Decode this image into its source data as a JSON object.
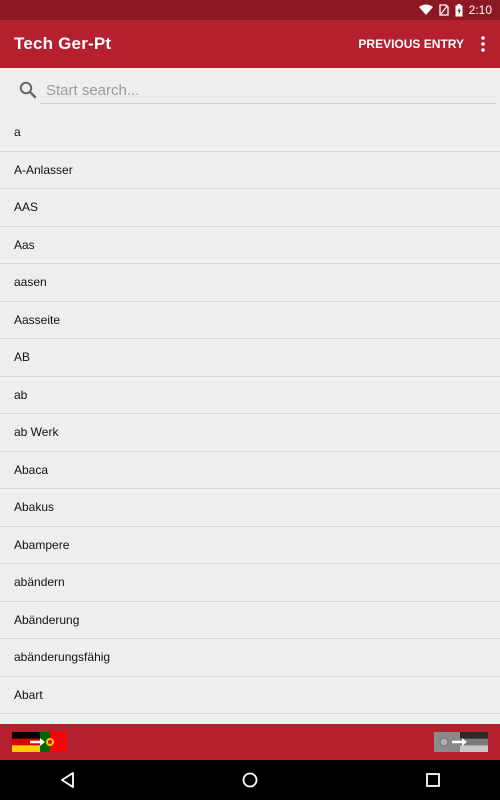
{
  "status_bar": {
    "time": "2:10"
  },
  "app_bar": {
    "title": "Tech Ger-Pt",
    "previous_entry": "PREVIOUS ENTRY"
  },
  "search": {
    "placeholder": "Start search..."
  },
  "entries": [
    "a",
    "A-Anlasser",
    "AAS",
    "Aas",
    "aasen",
    "Aasseite",
    "AB",
    "ab",
    "ab Werk",
    "Abaca",
    "Abakus",
    "Abampere",
    "abändern",
    "Abänderung",
    "abänderungsfähig",
    "Abart"
  ],
  "colors": {
    "primary": "#b5202e",
    "primary_dark": "#8c1823"
  }
}
